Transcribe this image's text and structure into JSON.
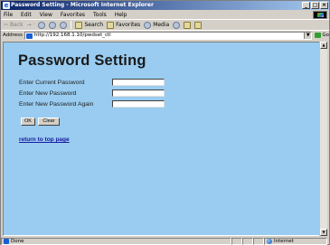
{
  "window": {
    "title": "Password Setting - Microsoft Internet Explorer",
    "controls": [
      "_",
      "□",
      "×"
    ]
  },
  "menu": [
    "File",
    "Edit",
    "View",
    "Favorites",
    "Tools",
    "Help"
  ],
  "toolbar": {
    "back": "Back",
    "forward_arrows": "→ ·",
    "search": "Search",
    "favorites": "Favorites",
    "media": "Media"
  },
  "address": {
    "label": "Address",
    "url": "http://192.168.1.10/pwdset_ctl",
    "go": "Go"
  },
  "page": {
    "title": "Password Setting",
    "fields": [
      {
        "label": "Enter Current Password"
      },
      {
        "label": "Enter New Password"
      },
      {
        "label": "Enter New Password Again"
      }
    ],
    "ok_button": "OK",
    "clear_button": "Clear",
    "top_link": "return to top page"
  },
  "status": {
    "text": "Done",
    "zone": "Internet"
  }
}
